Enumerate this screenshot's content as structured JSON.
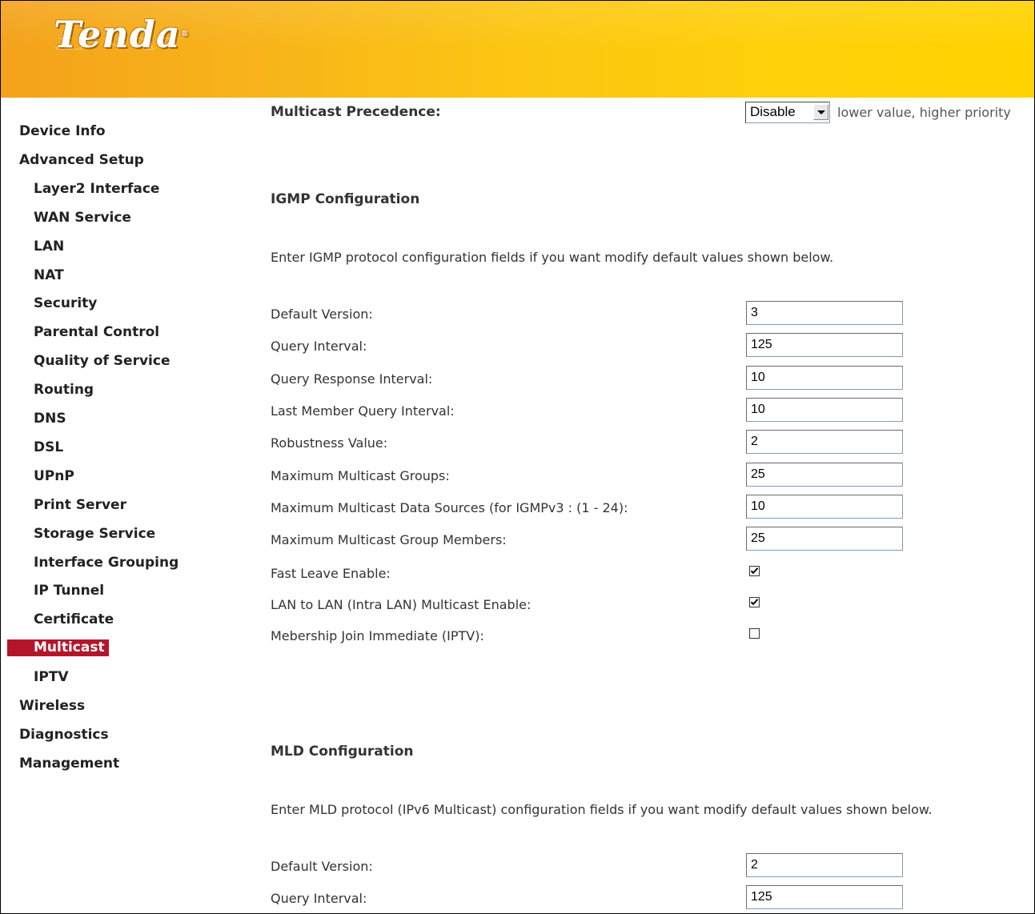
{
  "brand": {
    "logo_text": "Tenda",
    "header_colors": [
      "#f4a21a",
      "#ffd200"
    ]
  },
  "sidebar": {
    "active_color": "#b5152b",
    "items": [
      {
        "label": "Device Info",
        "level": 1
      },
      {
        "label": "Advanced Setup",
        "level": 1
      },
      {
        "label": "Layer2 Interface",
        "level": 2
      },
      {
        "label": "WAN Service",
        "level": 2
      },
      {
        "label": "LAN",
        "level": 2
      },
      {
        "label": "NAT",
        "level": 2
      },
      {
        "label": "Security",
        "level": 2
      },
      {
        "label": "Parental Control",
        "level": 2
      },
      {
        "label": "Quality of Service",
        "level": 2
      },
      {
        "label": "Routing",
        "level": 2
      },
      {
        "label": "DNS",
        "level": 2
      },
      {
        "label": "DSL",
        "level": 2
      },
      {
        "label": "UPnP",
        "level": 2
      },
      {
        "label": "Print Server",
        "level": 2
      },
      {
        "label": "Storage Service",
        "level": 2
      },
      {
        "label": "Interface Grouping",
        "level": 2
      },
      {
        "label": "IP Tunnel",
        "level": 2
      },
      {
        "label": "Certificate",
        "level": 2
      },
      {
        "label": "Multicast",
        "level": 2,
        "active": true
      },
      {
        "label": "IPTV",
        "level": 2
      },
      {
        "label": "Wireless",
        "level": 1
      },
      {
        "label": "Diagnostics",
        "level": 1
      },
      {
        "label": "Management",
        "level": 1
      }
    ]
  },
  "main": {
    "precedence": {
      "label": "Multicast Precedence:",
      "selected": "Disable",
      "hint": "lower value, higher priority"
    },
    "igmp": {
      "title": "IGMP Configuration",
      "description": "Enter IGMP protocol configuration fields if you want modify default values shown below.",
      "fields": [
        {
          "label": "Default Version:",
          "value": "3"
        },
        {
          "label": "Query Interval:",
          "value": "125"
        },
        {
          "label": "Query Response Interval:",
          "value": "10"
        },
        {
          "label": "Last Member Query Interval:",
          "value": "10"
        },
        {
          "label": "Robustness Value:",
          "value": "2"
        },
        {
          "label": "Maximum Multicast Groups:",
          "value": "25"
        },
        {
          "label": "Maximum Multicast Data Sources (for IGMPv3 : (1 - 24):",
          "value": "10"
        },
        {
          "label": "Maximum Multicast Group Members:",
          "value": "25"
        }
      ],
      "checkboxes": [
        {
          "label": "Fast Leave Enable:",
          "checked": true
        },
        {
          "label": "LAN to LAN (Intra LAN) Multicast Enable:",
          "checked": true
        },
        {
          "label": "Mebership Join Immediate (IPTV):",
          "checked": false
        }
      ]
    },
    "mld": {
      "title": "MLD Configuration",
      "description": "Enter MLD protocol (IPv6 Multicast) configuration fields if you want modify default values shown below.",
      "fields": [
        {
          "label": "Default Version:",
          "value": "2"
        },
        {
          "label": "Query Interval:",
          "value": "125"
        }
      ]
    }
  }
}
